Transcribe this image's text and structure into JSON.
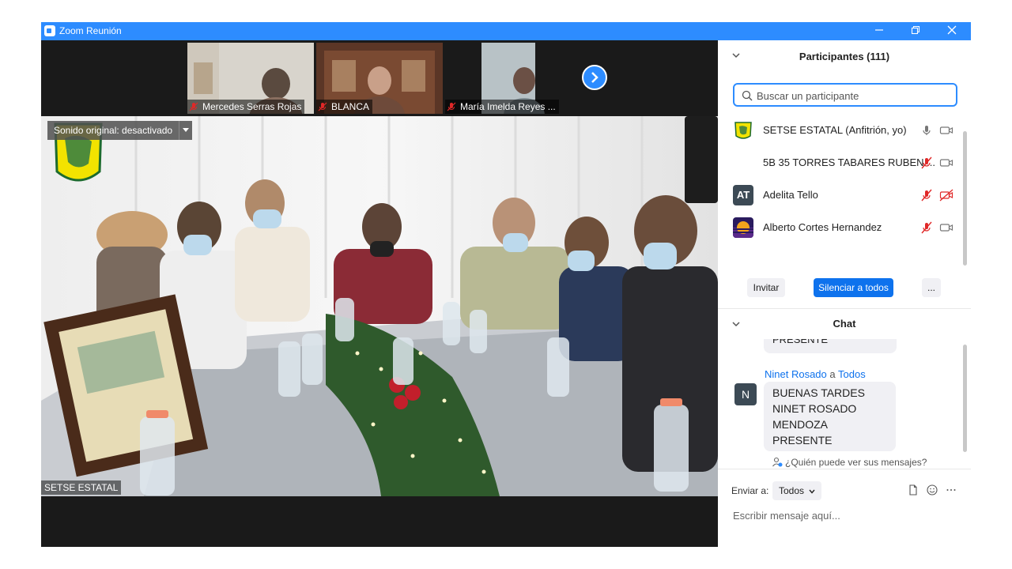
{
  "window": {
    "title": "Zoom Reunión",
    "controls": [
      "minimize",
      "restore",
      "close"
    ]
  },
  "thumbnails": [
    {
      "name": "Mercedes Serras Rojas",
      "muted": true
    },
    {
      "name": "BLANCA",
      "muted": true
    },
    {
      "name": "María Imelda Reyes ...",
      "muted": true
    }
  ],
  "main_video": {
    "original_sound_label": "Sonido original: desactivado",
    "speaker_name": "SETSE ESTATAL"
  },
  "participants": {
    "header": "Participantes (111)",
    "search_placeholder": "Buscar un participante",
    "list": [
      {
        "name": "SETSE ESTATAL (Anfitrión, yo)",
        "avatar_type": "logo",
        "mic": "on",
        "video": "on"
      },
      {
        "name": "5B 35 TORRES TABARES RUBEN ...",
        "avatar_type": "none",
        "mic": "muted",
        "video": "on"
      },
      {
        "name": "Adelita Tello",
        "avatar_type": "initials",
        "initials": "AT",
        "mic": "muted",
        "video": "off"
      },
      {
        "name": "Alberto Cortes Hernandez",
        "avatar_type": "image",
        "mic": "muted",
        "video": "on"
      }
    ],
    "buttons": {
      "invite": "Invitar",
      "mute_all": "Silenciar a todos",
      "more": "..."
    }
  },
  "chat": {
    "header": "Chat",
    "previous_message_fragment": "PRESENTE",
    "message": {
      "sender": "Ninet Rosado",
      "connector": "a",
      "recipient": "Todos",
      "avatar_initial": "N",
      "text": "BUENAS TARDES NINET ROSADO MENDOZA PRESENTE"
    },
    "who_can_see": "¿Quién puede ver sus mensajes?",
    "send_to_label": "Enviar a:",
    "send_to_value": "Todos",
    "input_placeholder": "Escribir mensaje aquí..."
  },
  "colors": {
    "titlebar": "#2d8cff",
    "primary_button": "#0e72ed",
    "link": "#0e72ed",
    "muted_mic": "#e02828",
    "video_background": "#1a1a1a"
  }
}
